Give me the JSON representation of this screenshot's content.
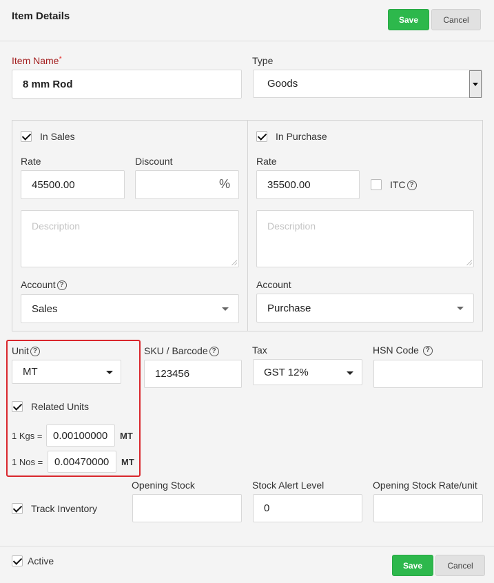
{
  "header": {
    "title": "Item Details",
    "save_label": "Save",
    "cancel_label": "Cancel"
  },
  "item_name": {
    "label": "Item Name",
    "required_mark": "*",
    "value": "8 mm Rod"
  },
  "type": {
    "label": "Type",
    "value": "Goods"
  },
  "sales": {
    "checkbox_label": "In Sales",
    "checked": true,
    "rate_label": "Rate",
    "rate_value": "45500.00",
    "discount_label": "Discount",
    "discount_value": "",
    "discount_unit": "%",
    "description_placeholder": "Description",
    "account_label": "Account",
    "account_value": "Sales"
  },
  "purchase": {
    "checkbox_label": "In Purchase",
    "checked": true,
    "rate_label": "Rate",
    "rate_value": "35500.00",
    "itc_label": "ITC",
    "itc_checked": false,
    "description_placeholder": "Description",
    "account_label": "Account",
    "account_value": "Purchase"
  },
  "unit": {
    "label": "Unit",
    "value": "MT"
  },
  "sku": {
    "label": "SKU / Barcode",
    "value": "123456"
  },
  "tax": {
    "label": "Tax",
    "value": "GST 12%"
  },
  "hsn": {
    "label": "HSN Code",
    "value": ""
  },
  "related_units": {
    "label": "Related Units",
    "checked": true,
    "rows": [
      {
        "prefix": "1 Kgs =",
        "value": "0.00100000",
        "unit": "MT"
      },
      {
        "prefix": "1 Nos =",
        "value": "0.00470000",
        "unit": "MT"
      }
    ]
  },
  "inventory": {
    "track_label": "Track Inventory",
    "track_checked": true,
    "opening_stock_label": "Opening Stock",
    "opening_stock_value": "",
    "alert_level_label": "Stock Alert Level",
    "alert_level_value": "0",
    "opening_rate_label": "Opening Stock Rate/unit",
    "opening_rate_value": ""
  },
  "footer": {
    "active_label": "Active",
    "active_checked": true,
    "save_label": "Save",
    "cancel_label": "Cancel"
  },
  "help_glyph": "?",
  "colors": {
    "save": "#2db84c",
    "highlight": "#d9262c",
    "required": "#a31f1f"
  }
}
